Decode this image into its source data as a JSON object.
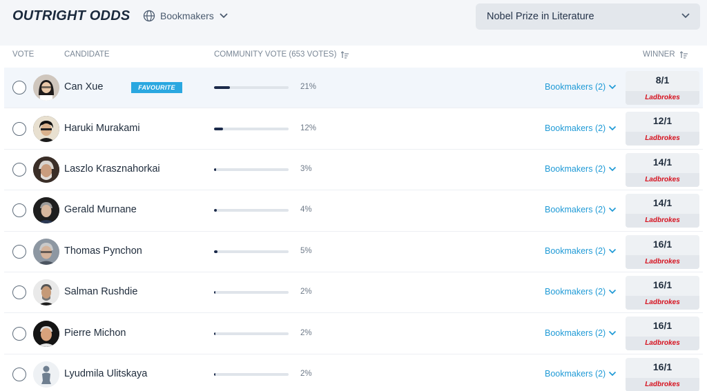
{
  "header": {
    "title": "OUTRIGHT ODDS",
    "bookmakers_label": "Bookmakers",
    "market_select": "Nobel Prize in Literature"
  },
  "columns": {
    "vote": "VOTE",
    "candidate": "CANDIDATE",
    "community": "COMMUNITY VOTE (653 VOTES)",
    "winner": "WINNER"
  },
  "colors": {
    "accent": "#1f9ad6",
    "badge": "#2aa7e0",
    "bar_fill": "#1b2a4a",
    "ladbrokes": "#d6111e"
  },
  "rows": [
    {
      "name": "Can Xue",
      "badge": "FAVOURITE",
      "vote_pct": 21,
      "vote_label": "21%",
      "bookmakers": "Bookmakers (2)",
      "odds": "8/1",
      "bookmaker": "Ladbrokes"
    },
    {
      "name": "Haruki Murakami",
      "vote_pct": 12,
      "vote_label": "12%",
      "bookmakers": "Bookmakers (2)",
      "odds": "12/1",
      "bookmaker": "Ladbrokes"
    },
    {
      "name": "Laszlo Krasznahorkai",
      "vote_pct": 3,
      "vote_label": "3%",
      "bookmakers": "Bookmakers (2)",
      "odds": "14/1",
      "bookmaker": "Ladbrokes"
    },
    {
      "name": "Gerald Murnane",
      "vote_pct": 4,
      "vote_label": "4%",
      "bookmakers": "Bookmakers (2)",
      "odds": "14/1",
      "bookmaker": "Ladbrokes"
    },
    {
      "name": "Thomas Pynchon",
      "vote_pct": 5,
      "vote_label": "5%",
      "bookmakers": "Bookmakers (2)",
      "odds": "16/1",
      "bookmaker": "Ladbrokes"
    },
    {
      "name": "Salman Rushdie",
      "vote_pct": 2,
      "vote_label": "2%",
      "bookmakers": "Bookmakers (2)",
      "odds": "16/1",
      "bookmaker": "Ladbrokes"
    },
    {
      "name": "Pierre Michon",
      "vote_pct": 2,
      "vote_label": "2%",
      "bookmakers": "Bookmakers (2)",
      "odds": "16/1",
      "bookmaker": "Ladbrokes"
    },
    {
      "name": "Lyudmila Ulitskaya",
      "vote_pct": 2,
      "vote_label": "2%",
      "bookmakers": "Bookmakers (2)",
      "odds": "16/1",
      "bookmaker": "Ladbrokes"
    }
  ]
}
